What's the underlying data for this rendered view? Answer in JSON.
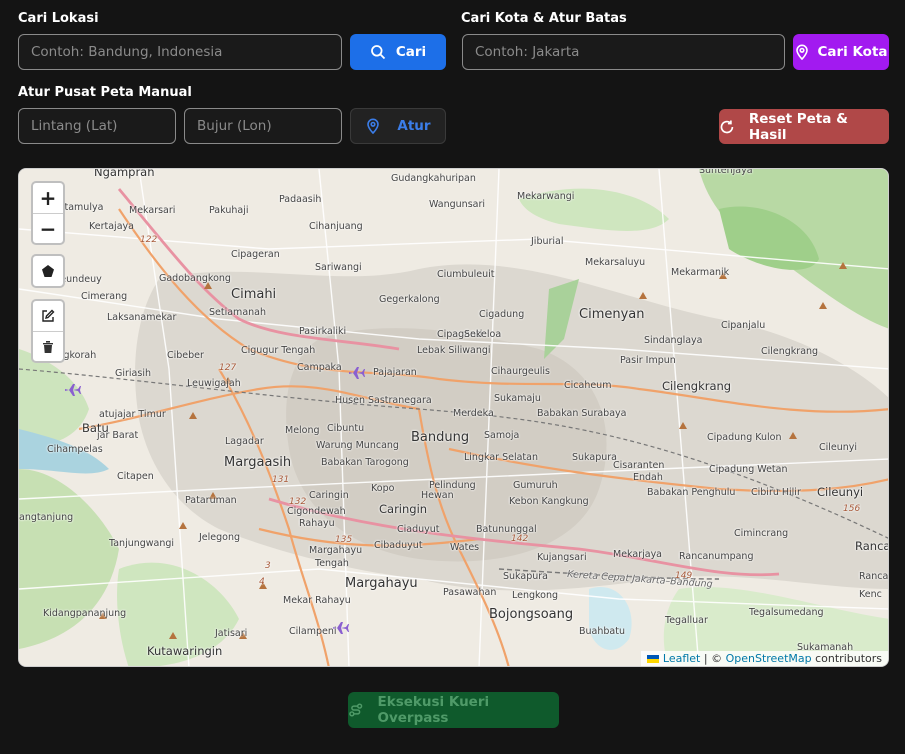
{
  "search": {
    "label": "Cari Lokasi",
    "placeholder": "Contoh: Bandung, Indonesia",
    "button_label": "Cari"
  },
  "city": {
    "label": "Cari Kota & Atur Batas",
    "placeholder": "Contoh: Jakarta",
    "button_label": "Cari Kota"
  },
  "manual": {
    "label": "Atur Pusat Peta Manual",
    "lat_placeholder": "Lintang (Lat)",
    "lon_placeholder": "Bujur (Lon)",
    "button_label": "Atur"
  },
  "reset": {
    "button_label": "Reset Peta & Hasil"
  },
  "map": {
    "controls": {
      "zoom_in": "+",
      "zoom_out": "−"
    },
    "attribution": {
      "leaflet": "Leaflet",
      "separator": " | © ",
      "osm": "OpenStreetMap",
      "suffix": " contributors"
    },
    "places": [
      {
        "name": "Ngamprah",
        "size": "mid"
      },
      {
        "name": "Gudangkahuripan",
        "size": "sm"
      },
      {
        "name": "Suntenjaya",
        "size": "sm"
      },
      {
        "name": "Kertamulya",
        "size": "sm"
      },
      {
        "name": "Mekarsari",
        "size": "sm"
      },
      {
        "name": "Pakuhaji",
        "size": "sm"
      },
      {
        "name": "Padaasih",
        "size": "sm"
      },
      {
        "name": "Wangunsari",
        "size": "sm"
      },
      {
        "name": "Mekarwangi",
        "size": "sm"
      },
      {
        "name": "Kertajaya",
        "size": "sm"
      },
      {
        "name": "Cihanjuang",
        "size": "sm"
      },
      {
        "name": "Jiburial",
        "size": "sm"
      },
      {
        "name": "Cipageran",
        "size": "sm"
      },
      {
        "name": "Sariwangi",
        "size": "sm"
      },
      {
        "name": "Mekarsaluyu",
        "size": "sm"
      },
      {
        "name": "Cipeundeuy",
        "size": "sm"
      },
      {
        "name": "Gadobangkong",
        "size": "sm"
      },
      {
        "name": "Ciumbuleuit",
        "size": "sm"
      },
      {
        "name": "Mekarmanik",
        "size": "sm"
      },
      {
        "name": "Cimahi",
        "size": "big"
      },
      {
        "name": "Cimerang",
        "size": "sm"
      },
      {
        "name": "Gegerkalong",
        "size": "sm"
      },
      {
        "name": "Setiamanah",
        "size": "sm"
      },
      {
        "name": "Cigadung",
        "size": "sm"
      },
      {
        "name": "Cimenyan",
        "size": "big"
      },
      {
        "name": "Laksanamekar",
        "size": "sm"
      },
      {
        "name": "Cipanjalu",
        "size": "sm"
      },
      {
        "name": "Pasirkaliki",
        "size": "sm"
      },
      {
        "name": "Cipaganti",
        "size": "sm"
      },
      {
        "name": "Sekeloa",
        "size": "sm"
      },
      {
        "name": "Sindanglaya",
        "size": "sm"
      },
      {
        "name": "Cangkorah",
        "size": "sm"
      },
      {
        "name": "Cibeber",
        "size": "sm"
      },
      {
        "name": "Cigugur Tengah",
        "size": "sm"
      },
      {
        "name": "Lebak Siliwangi",
        "size": "sm"
      },
      {
        "name": "Cilengkrang",
        "size": "sm"
      },
      {
        "name": "Pasir Impun",
        "size": "sm"
      },
      {
        "name": "Campaka",
        "size": "sm"
      },
      {
        "name": "Pajajaran",
        "size": "sm"
      },
      {
        "name": "Cihaurgeulis",
        "size": "sm"
      },
      {
        "name": "Giriasih",
        "size": "sm"
      },
      {
        "name": "Leuwigajah",
        "size": "sm"
      },
      {
        "name": "Cicaheum",
        "size": "sm"
      },
      {
        "name": "Cilengkrang",
        "size": "mid"
      },
      {
        "name": "Husen Sastranegara",
        "size": "sm"
      },
      {
        "name": "Sukamaju",
        "size": "sm"
      },
      {
        "name": "Merdeka",
        "size": "sm"
      },
      {
        "name": "Babakan Surabaya",
        "size": "sm"
      },
      {
        "name": "atujajar Timur",
        "size": "sm"
      },
      {
        "name": "Batu",
        "size": "mid"
      },
      {
        "name": "jar Barat",
        "size": "sm"
      },
      {
        "name": "Lagadar",
        "size": "sm"
      },
      {
        "name": "Melong",
        "size": "sm"
      },
      {
        "name": "Cibuntu",
        "size": "sm"
      },
      {
        "name": "Bandung",
        "size": "big"
      },
      {
        "name": "Samoja",
        "size": "sm"
      },
      {
        "name": "Cipadung Kulon",
        "size": "sm"
      },
      {
        "name": "Cihampelas",
        "size": "sm"
      },
      {
        "name": "Warung Muncang",
        "size": "sm"
      },
      {
        "name": "Cileunyi",
        "size": "sm"
      },
      {
        "name": "Lingkar Selatan",
        "size": "sm"
      },
      {
        "name": "Sukapura",
        "size": "sm"
      },
      {
        "name": "Margaasih",
        "size": "big"
      },
      {
        "name": "Babakan Tarogong",
        "size": "sm"
      },
      {
        "name": "Cisaranten",
        "size": "sm"
      },
      {
        "name": "Cipadung Wetan",
        "size": "sm"
      },
      {
        "name": "Citapen",
        "size": "sm"
      },
      {
        "name": "Endah",
        "size": "sm"
      },
      {
        "name": "Kopo",
        "size": "sm"
      },
      {
        "name": "Pelindung",
        "size": "sm"
      },
      {
        "name": "Gumuruh",
        "size": "sm"
      },
      {
        "name": "Babakan Penghulu",
        "size": "sm"
      },
      {
        "name": "Cibiru Hilir",
        "size": "sm"
      },
      {
        "name": "Cileunyi",
        "size": "mid"
      },
      {
        "name": "Pataruman",
        "size": "sm"
      },
      {
        "name": "Caringin",
        "size": "sm"
      },
      {
        "name": "Hewan",
        "size": "sm"
      },
      {
        "name": "Kebon Kangkung",
        "size": "sm"
      },
      {
        "name": "angtanjung",
        "size": "sm"
      },
      {
        "name": "Cigondewah",
        "size": "sm"
      },
      {
        "name": "Caringin",
        "size": "mid"
      },
      {
        "name": "Rahayu",
        "size": "sm"
      },
      {
        "name": "Ciaduyut",
        "size": "sm"
      },
      {
        "name": "Batununggal",
        "size": "sm"
      },
      {
        "name": "Cimincrang",
        "size": "sm"
      },
      {
        "name": "Jelegong",
        "size": "sm"
      },
      {
        "name": "Tanjungwangi",
        "size": "sm"
      },
      {
        "name": "Cibaduyut",
        "size": "sm"
      },
      {
        "name": "Wates",
        "size": "sm"
      },
      {
        "name": "Margahayu",
        "size": "sm"
      },
      {
        "name": "Tengah",
        "size": "sm"
      },
      {
        "name": "Kujangsari",
        "size": "sm"
      },
      {
        "name": "Mekarjaya",
        "size": "sm"
      },
      {
        "name": "Rancanumpang",
        "size": "sm"
      },
      {
        "name": "Ranca",
        "size": "mid"
      },
      {
        "name": "Sukapura",
        "size": "sm"
      },
      {
        "name": "Margahayu",
        "size": "big"
      },
      {
        "name": "Mekar Rahayu",
        "size": "sm"
      },
      {
        "name": "Pasawahan",
        "size": "sm"
      },
      {
        "name": "Lengkong",
        "size": "sm"
      },
      {
        "name": "Kidangpananjung",
        "size": "sm"
      },
      {
        "name": "Bojongsoang",
        "size": "big"
      },
      {
        "name": "Tegalsumedang",
        "size": "sm"
      },
      {
        "name": "Tegalluar",
        "size": "sm"
      },
      {
        "name": "Cilampeni",
        "size": "sm"
      },
      {
        "name": "Jatisari",
        "size": "sm"
      },
      {
        "name": "Buahbatu",
        "size": "sm"
      },
      {
        "name": "Kutawaringin",
        "size": "mid"
      },
      {
        "name": "Sukamanah",
        "size": "sm"
      },
      {
        "name": "Kenc",
        "size": "sm"
      },
      {
        "name": "Ranca",
        "size": "sm"
      },
      {
        "name": "Kereta Cepat Jakarta–Bandung",
        "size": "sm"
      }
    ],
    "route_numbers": [
      "122",
      "127",
      "131",
      "132",
      "135",
      "142",
      "149",
      "156",
      "3",
      "4"
    ]
  },
  "overpass": {
    "button_label": "Eksekusi Kueri Overpass"
  },
  "colors": {
    "background": "#141414",
    "primary_blue": "#1d6fe8",
    "purple": "#a21af0",
    "reset_red": "#b04848",
    "overpass_green": "#0f5a2c"
  }
}
